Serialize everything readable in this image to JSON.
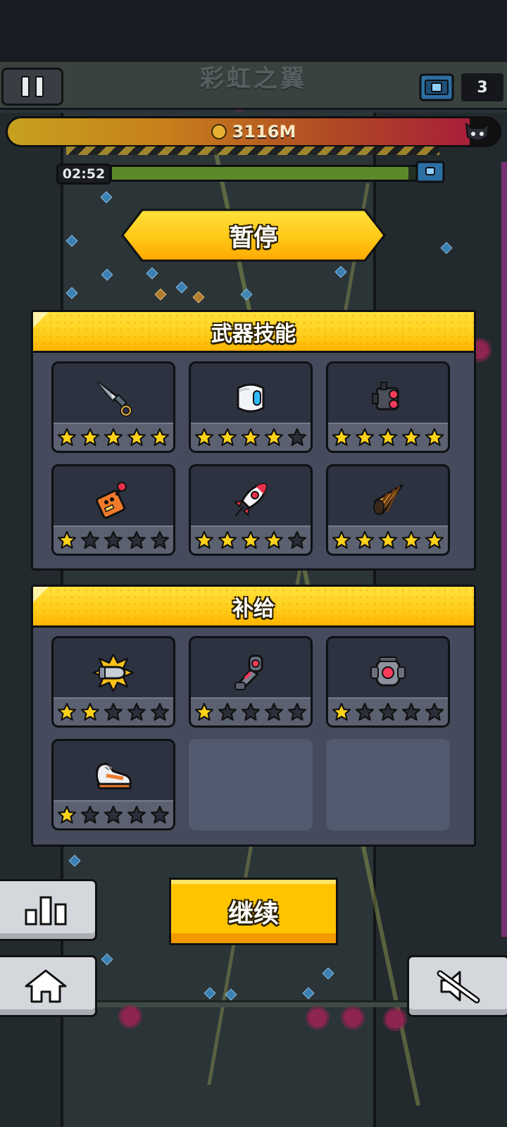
{
  "hud": {
    "level_name": "彩虹之翼",
    "chest_count": "3",
    "distance": "3116M",
    "distance_progress": 0.94,
    "timer": "02:52",
    "time_progress": 0.97
  },
  "pause_menu": {
    "title": "暂停",
    "weapons_section": {
      "title": "武器技能",
      "items": [
        {
          "icon": "kunai-icon",
          "stars": 5,
          "max_stars": 5
        },
        {
          "icon": "drone-icon",
          "stars": 4,
          "max_stars": 5
        },
        {
          "icon": "laser-turret-icon",
          "stars": 5,
          "max_stars": 5
        },
        {
          "icon": "remote-controller-icon",
          "stars": 1,
          "max_stars": 5
        },
        {
          "icon": "rocket-icon",
          "stars": 4,
          "max_stars": 5
        },
        {
          "icon": "drill-icon",
          "stars": 5,
          "max_stars": 5
        }
      ]
    },
    "supply_section": {
      "title": "补给",
      "items": [
        {
          "icon": "bullet-blast-icon",
          "stars": 2,
          "max_stars": 5
        },
        {
          "icon": "armor-gauntlet-icon",
          "stars": 1,
          "max_stars": 5
        },
        {
          "icon": "energy-core-icon",
          "stars": 1,
          "max_stars": 5
        },
        {
          "icon": "sneaker-icon",
          "stars": 1,
          "max_stars": 5
        }
      ]
    },
    "continue_label": "继续"
  },
  "colors": {
    "accent_yellow": "#ffc400",
    "panel_bg": "#454b5c",
    "card_bg": "#2d3240",
    "star_filled": "#ffd21a",
    "star_empty": "#2a2f3b"
  }
}
